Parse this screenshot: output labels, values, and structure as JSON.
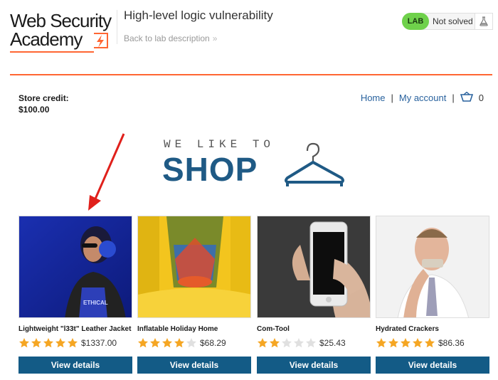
{
  "header": {
    "logo_line1": "Web Security",
    "logo_line2": "Academy",
    "lab_title": "High-level logic vulnerability",
    "back_link": "Back to lab description",
    "lab_badge": "LAB",
    "lab_status": "Not solved",
    "flask_icon": "flask-icon",
    "accent_color": "#ff6633",
    "badge_color": "#6fd14b"
  },
  "store": {
    "credit_label": "Store credit:",
    "credit_value": "$100.00",
    "nav": {
      "home": "Home",
      "separator": "|",
      "my_account": "My account",
      "cart_icon": "cart-icon",
      "cart_count": "0"
    }
  },
  "banner": {
    "small_text": "WE LIKE TO",
    "big_text": "SHOP",
    "icon": "hanger-icon",
    "color": "#1f5a85"
  },
  "annotation": {
    "icon": "red-arrow-icon",
    "color": "#e0201b"
  },
  "products": [
    {
      "name": "Lightweight \"l33t\" Leather Jacket",
      "price": "$1337.00",
      "rating": 5,
      "button": "View details"
    },
    {
      "name": "Inflatable Holiday Home",
      "price": "$68.29",
      "rating": 4,
      "button": "View details"
    },
    {
      "name": "Com-Tool",
      "price": "$25.43",
      "rating": 2,
      "button": "View details"
    },
    {
      "name": "Hydrated Crackers",
      "price": "$86.36",
      "rating": 5,
      "button": "View details"
    }
  ],
  "rating_max": 5,
  "colors": {
    "button": "#135b86",
    "star_filled": "#f5a623",
    "star_empty": "#e0e0e0",
    "link": "#29629e"
  }
}
